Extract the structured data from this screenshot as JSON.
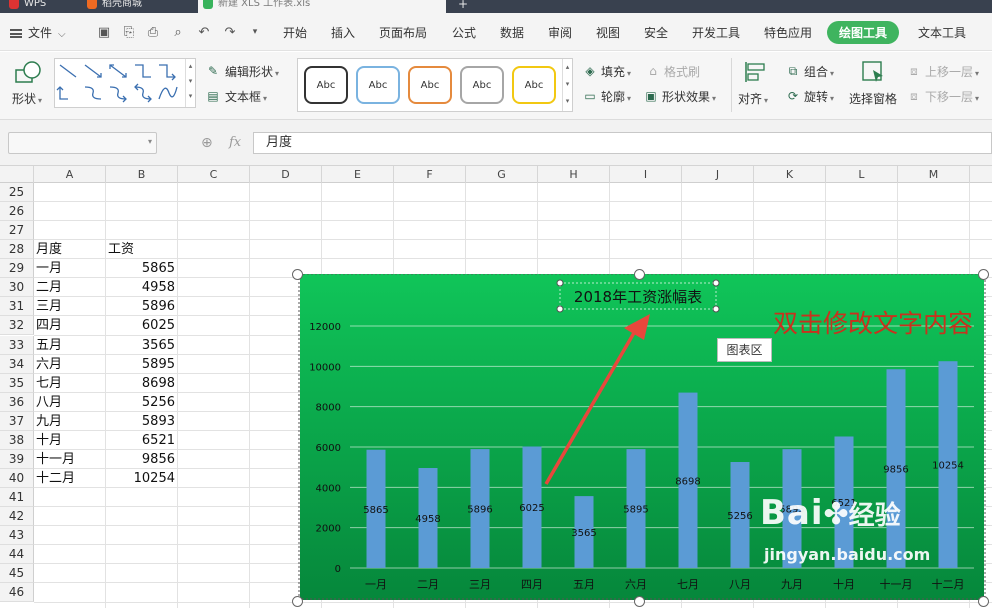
{
  "tabs": [
    {
      "label": "WPS"
    },
    {
      "label": "稻壳商城"
    },
    {
      "label": "新建 XLS 工作表.xls"
    }
  ],
  "menu": {
    "file_label": "文件",
    "items": [
      "开始",
      "插入",
      "页面布局",
      "公式",
      "数据",
      "审阅",
      "视图",
      "安全",
      "开发工具",
      "特色应用",
      "绘图工具",
      "文本工具"
    ]
  },
  "ribbon": {
    "shape_label": "形状",
    "edit_shape_label": "编辑形状",
    "textbox_label": "文本框",
    "style_samples": [
      "Abc",
      "Abc",
      "Abc",
      "Abc",
      "Abc"
    ],
    "fill_label": "填充",
    "format_brush_label": "格式刷",
    "outline_label": "轮廓",
    "shape_effect_label": "形状效果",
    "align_label": "对齐",
    "group_label": "组合",
    "rotate_label": "旋转",
    "select_pane_label": "选择窗格",
    "bring_forward_label": "上移一层",
    "send_backward_label": "下移一层"
  },
  "formula_bar": {
    "name_box": "",
    "fx_label": "fx",
    "content": "月度"
  },
  "sheet": {
    "columns": [
      "A",
      "B",
      "C",
      "D",
      "E",
      "F",
      "G",
      "H",
      "I",
      "J",
      "K",
      "L",
      "M"
    ],
    "rows": [
      "25",
      "26",
      "27",
      "28",
      "29",
      "30",
      "31",
      "32",
      "33",
      "34",
      "35",
      "36",
      "37",
      "38",
      "39",
      "40",
      "41",
      "42",
      "43",
      "44",
      "45",
      "46"
    ],
    "header": {
      "a": "月度",
      "b": "工资"
    },
    "data": [
      {
        "a": "一月",
        "b": "5865"
      },
      {
        "a": "二月",
        "b": "4958"
      },
      {
        "a": "三月",
        "b": "5896"
      },
      {
        "a": "四月",
        "b": "6025"
      },
      {
        "a": "五月",
        "b": "3565"
      },
      {
        "a": "六月",
        "b": "5895"
      },
      {
        "a": "七月",
        "b": "8698"
      },
      {
        "a": "八月",
        "b": "5256"
      },
      {
        "a": "九月",
        "b": "5893"
      },
      {
        "a": "十月",
        "b": "6521"
      },
      {
        "a": "十一月",
        "b": "9856"
      },
      {
        "a": "十二月",
        "b": "10254"
      }
    ]
  },
  "chart_data": {
    "type": "bar",
    "title": "2018年工资涨幅表",
    "categories": [
      "一月",
      "二月",
      "三月",
      "四月",
      "五月",
      "六月",
      "七月",
      "八月",
      "九月",
      "十月",
      "十一月",
      "十二月"
    ],
    "values": [
      5865,
      4958,
      5896,
      6025,
      3565,
      5895,
      8698,
      5256,
      5893,
      6521,
      9856,
      10254
    ],
    "yticks": [
      "0",
      "2000",
      "4000",
      "6000",
      "8000",
      "10000",
      "12000"
    ],
    "ylim": [
      0,
      12000
    ],
    "xlabel": "",
    "ylabel": "",
    "grid": true,
    "legend": "none",
    "bar_color": "#5b9bd5",
    "background_color": "#0fb552"
  },
  "chart_overlay": {
    "tooltip": "图表区",
    "annotation": "双击修改文字内容",
    "annotation_color": "#c8321e",
    "arrow_color": "#e8473c"
  },
  "watermark": {
    "brand": "Bai",
    "suffix": "经验",
    "site": "jingyan.baidu.com"
  },
  "colors": {
    "accent": "#3fb45f",
    "tab_bar": "#39414f"
  }
}
